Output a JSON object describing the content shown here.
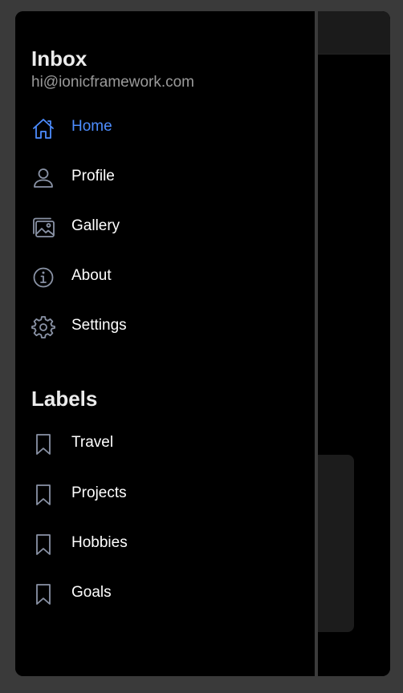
{
  "menu": {
    "title": "Inbox",
    "note": "hi@ionicframework.com",
    "items": [
      {
        "label": "Home",
        "icon": "home-icon",
        "active": true
      },
      {
        "label": "Profile",
        "icon": "person-icon",
        "active": false
      },
      {
        "label": "Gallery",
        "icon": "images-icon",
        "active": false
      },
      {
        "label": "About",
        "icon": "information-icon",
        "active": false
      },
      {
        "label": "Settings",
        "icon": "settings-icon",
        "active": false
      }
    ]
  },
  "labels": {
    "title": "Labels",
    "items": [
      {
        "label": "Travel",
        "icon": "bookmark-icon"
      },
      {
        "label": "Projects",
        "icon": "bookmark-icon"
      },
      {
        "label": "Hobbies",
        "icon": "bookmark-icon"
      },
      {
        "label": "Goals",
        "icon": "bookmark-icon"
      }
    ]
  },
  "colors": {
    "accent": "#4d8dff",
    "icon_inactive": "#8a93a6",
    "background": "#000000",
    "frame": "#3a3a3a"
  }
}
